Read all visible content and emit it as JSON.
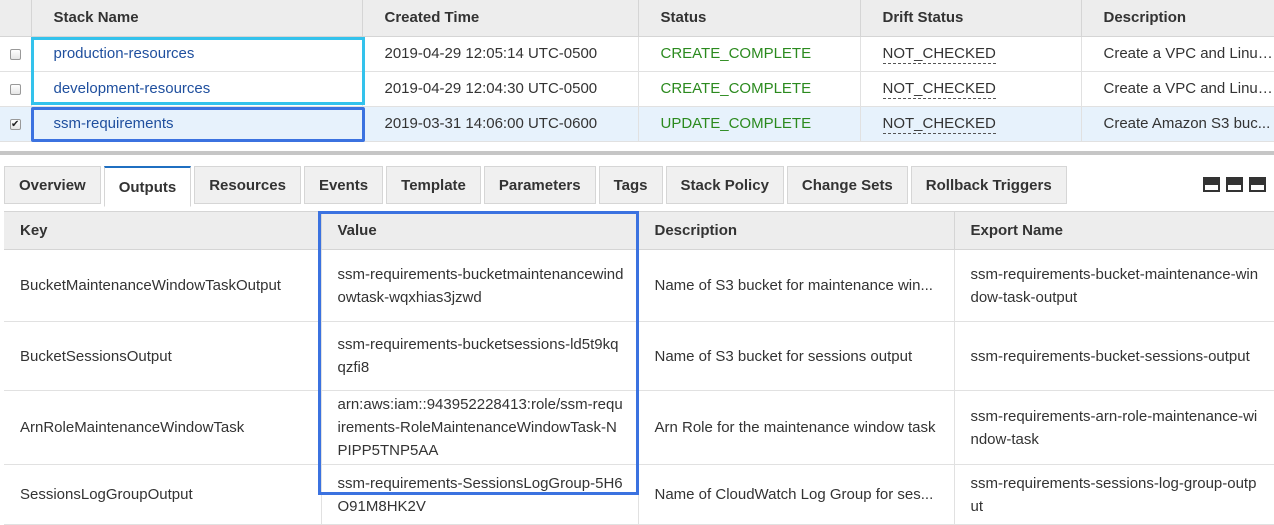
{
  "stacks": {
    "columns": [
      "Stack Name",
      "Created Time",
      "Status",
      "Drift Status",
      "Description"
    ],
    "rows": [
      {
        "checked": false,
        "name": "production-resources",
        "created": "2019-04-29 12:05:14 UTC-0500",
        "status": "CREATE_COMPLETE",
        "drift": "NOT_CHECKED",
        "description": "Create a VPC and Linux..."
      },
      {
        "checked": false,
        "name": "development-resources",
        "created": "2019-04-29 12:04:30 UTC-0500",
        "status": "CREATE_COMPLETE",
        "drift": "NOT_CHECKED",
        "description": "Create a VPC and Linux..."
      },
      {
        "checked": true,
        "name": "ssm-requirements",
        "created": "2019-03-31 14:06:00 UTC-0600",
        "status": "UPDATE_COMPLETE",
        "drift": "NOT_CHECKED",
        "description": "Create Amazon S3 buc..."
      }
    ]
  },
  "tabs": [
    "Overview",
    "Outputs",
    "Resources",
    "Events",
    "Template",
    "Parameters",
    "Tags",
    "Stack Policy",
    "Change Sets",
    "Rollback Triggers"
  ],
  "active_tab": "Outputs",
  "outputs": {
    "columns": [
      "Key",
      "Value",
      "Description",
      "Export Name"
    ],
    "rows": [
      {
        "key": "BucketMaintenanceWindowTaskOutput",
        "value": "ssm-requirements-bucketmaintenancewindowtask-wqxhias3jzwd",
        "description": "Name of S3 bucket for maintenance win...",
        "export": "ssm-requirements-bucket-maintenance-window-task-output"
      },
      {
        "key": "BucketSessionsOutput",
        "value": "ssm-requirements-bucketsessions-ld5t9kqqzfi8",
        "description": "Name of S3 bucket for sessions output",
        "export": "ssm-requirements-bucket-sessions-output"
      },
      {
        "key": "ArnRoleMaintenanceWindowTask",
        "value": "arn:aws:iam::943952228413:role/ssm-requirements-RoleMaintenanceWindowTask-NPIPP5TNP5AA",
        "description": "Arn Role for the maintenance window task",
        "export": "ssm-requirements-arn-role-maintenance-window-task"
      },
      {
        "key": "SessionsLogGroupOutput",
        "value": "ssm-requirements-SessionsLogGroup-5H6O91M8HK2V",
        "description": "Name of CloudWatch Log Group for ses...",
        "export": "ssm-requirements-sessions-log-group-output"
      }
    ]
  },
  "colors": {
    "accent": "#3b72e0",
    "highlight": "#33c2ec",
    "status_ok": "#2b8a1e",
    "link": "#1f4f9e"
  },
  "icons": {
    "layout_icons": [
      "layout-split-icon",
      "layout-half-icon",
      "layout-full-icon"
    ]
  }
}
